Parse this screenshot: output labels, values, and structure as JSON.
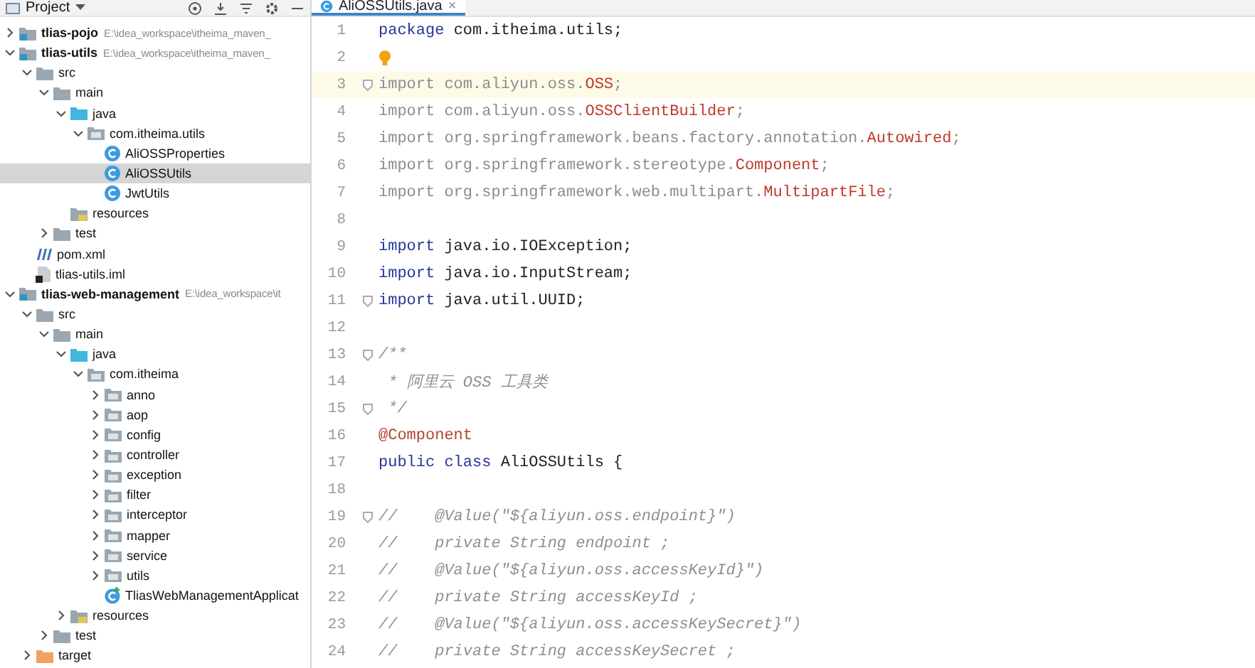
{
  "project_panel": {
    "title": "Project"
  },
  "tree": [
    {
      "label": "tlias-pojo",
      "path": "E:\\idea_workspace\\itheima_maven_",
      "kind": "module",
      "expanded": false,
      "selected": false
    },
    {
      "label": "tlias-utils",
      "path": "E:\\idea_workspace\\itheima_maven_",
      "kind": "module",
      "expanded": true,
      "selected": false,
      "children": [
        {
          "label": "src",
          "kind": "folder",
          "expanded": true,
          "selected": false,
          "children": [
            {
              "label": "main",
              "kind": "folder",
              "expanded": true,
              "selected": false,
              "children": [
                {
                  "label": "java",
                  "kind": "source",
                  "expanded": true,
                  "selected": false,
                  "children": [
                    {
                      "label": "com.itheima.utils",
                      "kind": "package",
                      "expanded": true,
                      "selected": false,
                      "children": [
                        {
                          "label": "AliOSSProperties",
                          "kind": "class",
                          "selected": false
                        },
                        {
                          "label": "AliOSSUtils",
                          "kind": "class",
                          "selected": true
                        },
                        {
                          "label": "JwtUtils",
                          "kind": "class",
                          "selected": false
                        }
                      ]
                    }
                  ]
                },
                {
                  "label": "resources",
                  "kind": "resources",
                  "selected": false
                }
              ]
            },
            {
              "label": "test",
              "kind": "folder",
              "expanded": false,
              "selected": false
            }
          ]
        },
        {
          "label": "pom.xml",
          "kind": "maven",
          "selected": false
        },
        {
          "label": "tlias-utils.iml",
          "kind": "iml",
          "selected": false
        }
      ]
    },
    {
      "label": "tlias-web-management",
      "path": "E:\\idea_workspace\\it",
      "kind": "module",
      "expanded": true,
      "selected": false,
      "children": [
        {
          "label": "src",
          "kind": "folder",
          "expanded": true,
          "selected": false,
          "children": [
            {
              "label": "main",
              "kind": "folder",
              "expanded": true,
              "selected": false,
              "children": [
                {
                  "label": "java",
                  "kind": "source",
                  "expanded": true,
                  "selected": false,
                  "children": [
                    {
                      "label": "com.itheima",
                      "kind": "package",
                      "expanded": true,
                      "selected": false,
                      "children": [
                        {
                          "label": "anno",
                          "kind": "package",
                          "expanded": false,
                          "selected": false
                        },
                        {
                          "label": "aop",
                          "kind": "package",
                          "expanded": false,
                          "selected": false
                        },
                        {
                          "label": "config",
                          "kind": "package",
                          "expanded": false,
                          "selected": false
                        },
                        {
                          "label": "controller",
                          "kind": "package",
                          "expanded": false,
                          "selected": false
                        },
                        {
                          "label": "exception",
                          "kind": "package",
                          "expanded": false,
                          "selected": false
                        },
                        {
                          "label": "filter",
                          "kind": "package",
                          "expanded": false,
                          "selected": false
                        },
                        {
                          "label": "interceptor",
                          "kind": "package",
                          "expanded": false,
                          "selected": false
                        },
                        {
                          "label": "mapper",
                          "kind": "package",
                          "expanded": false,
                          "selected": false
                        },
                        {
                          "label": "service",
                          "kind": "package",
                          "expanded": false,
                          "selected": false
                        },
                        {
                          "label": "utils",
                          "kind": "package",
                          "expanded": false,
                          "selected": false
                        },
                        {
                          "label": "TliasWebManagementApplicat",
                          "kind": "app",
                          "selected": false
                        }
                      ]
                    }
                  ]
                },
                {
                  "label": "resources",
                  "kind": "resources",
                  "expanded": false,
                  "selected": false
                }
              ]
            },
            {
              "label": "test",
              "kind": "folder",
              "expanded": false,
              "selected": false
            }
          ]
        },
        {
          "label": "target",
          "kind": "excluded",
          "expanded": false,
          "selected": false
        }
      ]
    }
  ],
  "editor": {
    "tabs": [
      {
        "label": "AliOSSUtils.java",
        "close": "×",
        "selected": true
      }
    ],
    "lines": [
      {
        "number": "1",
        "highlighted": false,
        "fold": false,
        "tokens": [
          {
            "kind": "keyword",
            "text": "package"
          },
          {
            "kind": "plain",
            "text": " com.itheima.utils;"
          }
        ]
      },
      {
        "number": "2",
        "highlighted": false,
        "fold": false,
        "bulb": true
      },
      {
        "number": "3",
        "highlighted": true,
        "fold": true,
        "tokens": [
          {
            "kind": "unused",
            "text": "import com.aliyun.oss."
          },
          {
            "kind": "type",
            "text": "OSS"
          },
          {
            "kind": "unused",
            "text": ";"
          }
        ]
      },
      {
        "number": "4",
        "highlighted": false,
        "fold": false,
        "tokens": [
          {
            "kind": "unused",
            "text": "import com.aliyun.oss."
          },
          {
            "kind": "type",
            "text": "OSSClientBuilder"
          },
          {
            "kind": "unused",
            "text": ";"
          }
        ]
      },
      {
        "number": "5",
        "highlighted": false,
        "fold": false,
        "tokens": [
          {
            "kind": "unused",
            "text": "import org.springframework.beans.factory.annotation."
          },
          {
            "kind": "type",
            "text": "Autowired"
          },
          {
            "kind": "unused",
            "text": ";"
          }
        ]
      },
      {
        "number": "6",
        "highlighted": false,
        "fold": false,
        "tokens": [
          {
            "kind": "unused",
            "text": "import org.springframework.stereotype."
          },
          {
            "kind": "type",
            "text": "Component"
          },
          {
            "kind": "unused",
            "text": ";"
          }
        ]
      },
      {
        "number": "7",
        "highlighted": false,
        "fold": false,
        "tokens": [
          {
            "kind": "unused",
            "text": "import org.springframework.web.multipart."
          },
          {
            "kind": "type",
            "text": "MultipartFile"
          },
          {
            "kind": "unused",
            "text": ";"
          }
        ]
      },
      {
        "number": "8",
        "highlighted": false,
        "fold": false
      },
      {
        "number": "9",
        "highlighted": false,
        "fold": false,
        "tokens": [
          {
            "kind": "keyword",
            "text": "import"
          },
          {
            "kind": "plain",
            "text": " java.io.IOException;"
          }
        ]
      },
      {
        "number": "10",
        "highlighted": false,
        "fold": false,
        "tokens": [
          {
            "kind": "keyword",
            "text": "import"
          },
          {
            "kind": "plain",
            "text": " java.io.InputStream;"
          }
        ]
      },
      {
        "number": "11",
        "highlighted": false,
        "fold": true,
        "tokens": [
          {
            "kind": "keyword",
            "text": "import"
          },
          {
            "kind": "plain",
            "text": " java.util.UUID;"
          }
        ]
      },
      {
        "number": "12",
        "highlighted": false,
        "fold": false
      },
      {
        "number": "13",
        "highlighted": false,
        "fold": true,
        "tokens": [
          {
            "kind": "doc",
            "text": "/**"
          }
        ]
      },
      {
        "number": "14",
        "highlighted": false,
        "fold": false,
        "tokens": [
          {
            "kind": "doc",
            "text": " * 阿里云 OSS 工具类"
          }
        ]
      },
      {
        "number": "15",
        "highlighted": false,
        "fold": true,
        "tokens": [
          {
            "kind": "doc",
            "text": " */"
          }
        ]
      },
      {
        "number": "16",
        "highlighted": false,
        "fold": false,
        "tokens": [
          {
            "kind": "annotation",
            "text": "@Component"
          }
        ]
      },
      {
        "number": "17",
        "highlighted": false,
        "fold": false,
        "tokens": [
          {
            "kind": "keyword",
            "text": "public class"
          },
          {
            "kind": "plain",
            "text": " AliOSSUtils {"
          }
        ]
      },
      {
        "number": "18",
        "highlighted": false,
        "fold": false
      },
      {
        "number": "19",
        "highlighted": false,
        "fold": true,
        "tokens": [
          {
            "kind": "comment",
            "text": "//    @Value(\"${aliyun.oss.endpoint}\")"
          }
        ]
      },
      {
        "number": "20",
        "highlighted": false,
        "fold": false,
        "tokens": [
          {
            "kind": "comment",
            "text": "//    private String endpoint ;"
          }
        ]
      },
      {
        "number": "21",
        "highlighted": false,
        "fold": false,
        "tokens": [
          {
            "kind": "comment",
            "text": "//    @Value(\"${aliyun.oss.accessKeyId}\")"
          }
        ]
      },
      {
        "number": "22",
        "highlighted": false,
        "fold": false,
        "tokens": [
          {
            "kind": "comment",
            "text": "//    private String accessKeyId ;"
          }
        ]
      },
      {
        "number": "23",
        "highlighted": false,
        "fold": false,
        "tokens": [
          {
            "kind": "comment",
            "text": "//    @Value(\"${aliyun.oss.accessKeySecret}\")"
          }
        ]
      },
      {
        "number": "24",
        "highlighted": false,
        "fold": false,
        "tokens": [
          {
            "kind": "comment",
            "text": "//    private String accessKeySecret ;"
          }
        ]
      }
    ]
  }
}
